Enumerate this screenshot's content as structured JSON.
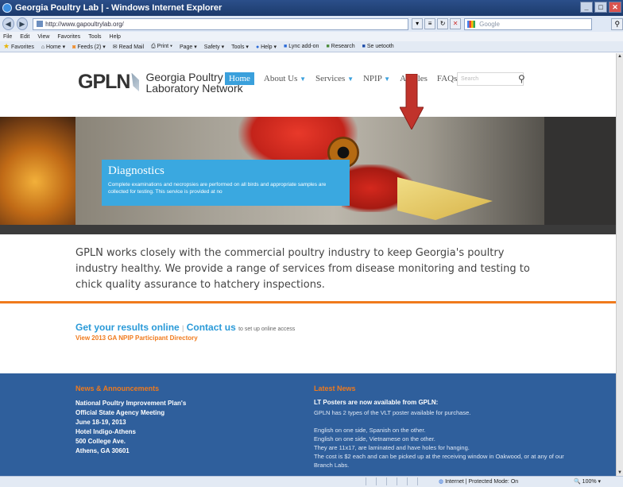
{
  "window": {
    "title": "Georgia Poultry Lab | - Windows Internet Explorer"
  },
  "browser": {
    "url": "http://www.gapoultrylab.org/",
    "search_placeholder": "Google",
    "menu": [
      "File",
      "Edit",
      "View",
      "Favorites",
      "Tools",
      "Help"
    ],
    "favorites_bar": [
      "Favorites",
      "Home",
      "Feeds (2)",
      "Read Mail",
      "Print",
      "Page",
      "Safety",
      "Tools",
      "Help",
      "Lync add-on",
      "Research",
      "Se",
      "uetooth"
    ]
  },
  "site": {
    "logo": "GPLN",
    "logo_sub_1": "Georgia Poultry",
    "logo_sub_2": "Laboratory Network",
    "nav": {
      "home": "Home",
      "about": "About Us",
      "services": "Services",
      "npip": "NPIP",
      "articles": "Articles",
      "faqs": "FAQs"
    },
    "search_placeholder": "Search",
    "banner": {
      "title": "Diagnostics",
      "text": "Complete examinations and necropsies are performed on all birds and appropriate samples are collected for testing. This service is provided at no"
    },
    "intro": "GPLN works closely with the commercial poultry industry to keep Georgia's poultry industry healthy. We provide a range of services from disease monitoring and testing to chick quality assurance to hatchery inspections.",
    "results_link": "Get your results online",
    "contact_link": "Contact us",
    "contact_rest": "to set up online access",
    "npip_directory": "View 2013 GA NPIP Participant Directory",
    "news": {
      "heading": "News & Announcements",
      "lines": [
        "National Poultry Improvement Plan's",
        "Official State Agency Meeting",
        "June 18-19, 2013",
        "Hotel Indigo-Athens",
        "500 College Ave.",
        "Athens, GA 30601"
      ]
    },
    "latest": {
      "heading": "Latest News",
      "title": "LT Posters are now available from GPLN:",
      "lines": [
        "GPLN has 2 types of the VLT poster available for purchase.",
        "",
        "English on one side, Spanish on the other.",
        "English on one side, Vietnamese on the other.",
        "They are 11x17, are laminated and have holes for hanging.",
        "The cost is $2 each and can be picked up at the receiving window in Oakwood, or at any of our",
        "Branch Labs."
      ]
    }
  },
  "status": {
    "zone": "Internet | Protected Mode: On",
    "zoom": "100%"
  },
  "colors": {
    "accent_blue": "#3aa0dc",
    "accent_orange": "#f07a1c",
    "news_bg": "#2f5f9c",
    "arrow_red": "#c0332b"
  }
}
